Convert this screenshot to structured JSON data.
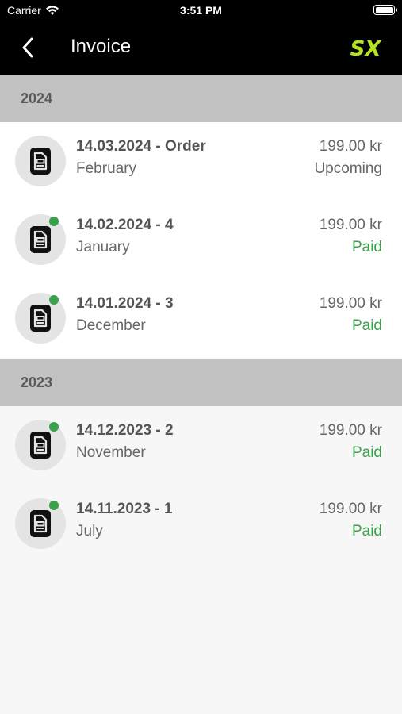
{
  "status_bar": {
    "carrier": "Carrier",
    "time": "3:51 PM"
  },
  "header": {
    "title": "Invoice",
    "logo_text": "SX"
  },
  "colors": {
    "accent": "#3aa14a",
    "logo": "#b5e61d",
    "header_bg": "#000000",
    "section_bg": "#c2c2c2"
  },
  "sections": [
    {
      "year": "2024",
      "items": [
        {
          "title": "14.03.2024 - Order",
          "subtitle": "February",
          "amount": "199.00 kr",
          "status": "Upcoming",
          "unread": false
        },
        {
          "title": "14.02.2024 - 4",
          "subtitle": "January",
          "amount": "199.00 kr",
          "status": "Paid",
          "unread": true
        },
        {
          "title": "14.01.2024 - 3",
          "subtitle": "December",
          "amount": "199.00 kr",
          "status": "Paid",
          "unread": true
        }
      ]
    },
    {
      "year": "2023",
      "items": [
        {
          "title": "14.12.2023 - 2",
          "subtitle": "November",
          "amount": "199.00 kr",
          "status": "Paid",
          "unread": true
        },
        {
          "title": "14.11.2023 - 1",
          "subtitle": "July",
          "amount": "199.00 kr",
          "status": "Paid",
          "unread": true
        }
      ]
    }
  ]
}
